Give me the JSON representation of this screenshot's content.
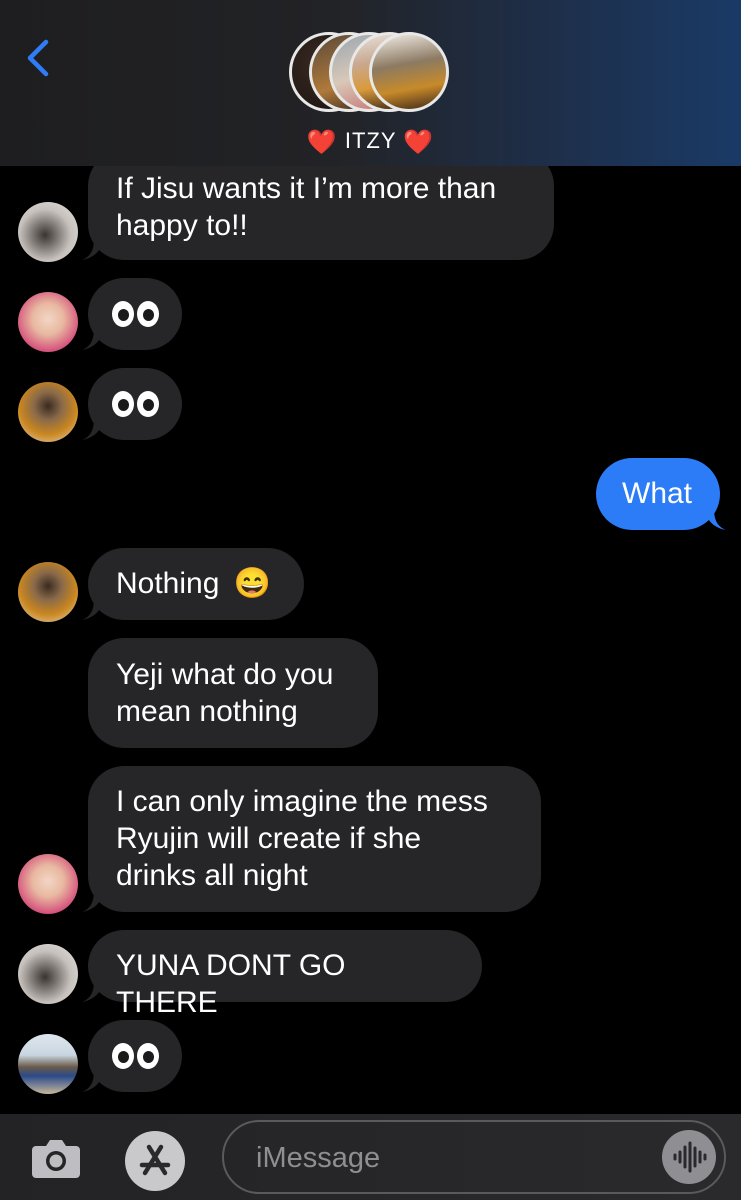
{
  "header": {
    "group_name": "ITZY",
    "heart_left": "❤️",
    "heart_right": "❤️",
    "back_icon": "chevron-left-icon"
  },
  "messages": [
    {
      "lines": [
        "If Jisu wants it I’m more than",
        "happy to!!"
      ]
    },
    {
      "emoji": "eyes"
    },
    {
      "emoji": "eyes"
    },
    {
      "text": "What"
    },
    {
      "text": "Nothing",
      "emoji": "😄"
    },
    {
      "lines": [
        "Yeji what do you",
        "mean nothing"
      ]
    },
    {
      "lines": [
        "I can only imagine the mess",
        "Ryujin will create if she",
        "drinks all night"
      ]
    },
    {
      "text": "YUNA DONT GO THERE"
    },
    {
      "emoji": "eyes"
    }
  ],
  "composer": {
    "placeholder": "iMessage",
    "camera_icon": "camera-icon",
    "apps_icon": "app-store-icon",
    "audio_icon": "audio-waveform-icon"
  },
  "colors": {
    "incoming_bubble": "#262628",
    "outgoing_bubble": "#2b7cf6",
    "accent": "#2f7df6"
  }
}
